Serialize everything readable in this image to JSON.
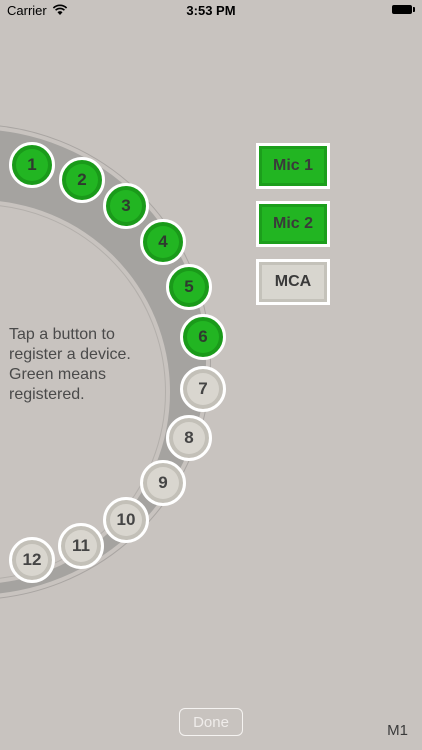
{
  "status_bar": {
    "carrier": "Carrier",
    "time": "3:53 PM"
  },
  "channels": [
    {
      "label": "1",
      "registered": true
    },
    {
      "label": "2",
      "registered": true
    },
    {
      "label": "3",
      "registered": true
    },
    {
      "label": "4",
      "registered": true
    },
    {
      "label": "5",
      "registered": true
    },
    {
      "label": "6",
      "registered": true
    },
    {
      "label": "7",
      "registered": false
    },
    {
      "label": "8",
      "registered": false
    },
    {
      "label": "9",
      "registered": false
    },
    {
      "label": "10",
      "registered": false
    },
    {
      "label": "11",
      "registered": false
    },
    {
      "label": "12",
      "registered": false
    }
  ],
  "instruction": "Tap a button to register a device. Green means registered.",
  "devices": [
    {
      "label": "Mic 1",
      "registered": true
    },
    {
      "label": "Mic 2",
      "registered": true
    },
    {
      "label": "MCA",
      "registered": false
    }
  ],
  "done_label": "Done",
  "mode_label": "M1",
  "colors": {
    "registered": "#22b522",
    "unregistered": "#d9d6cf",
    "background": "#c8c3bf",
    "ring": "#a5a3a0"
  }
}
